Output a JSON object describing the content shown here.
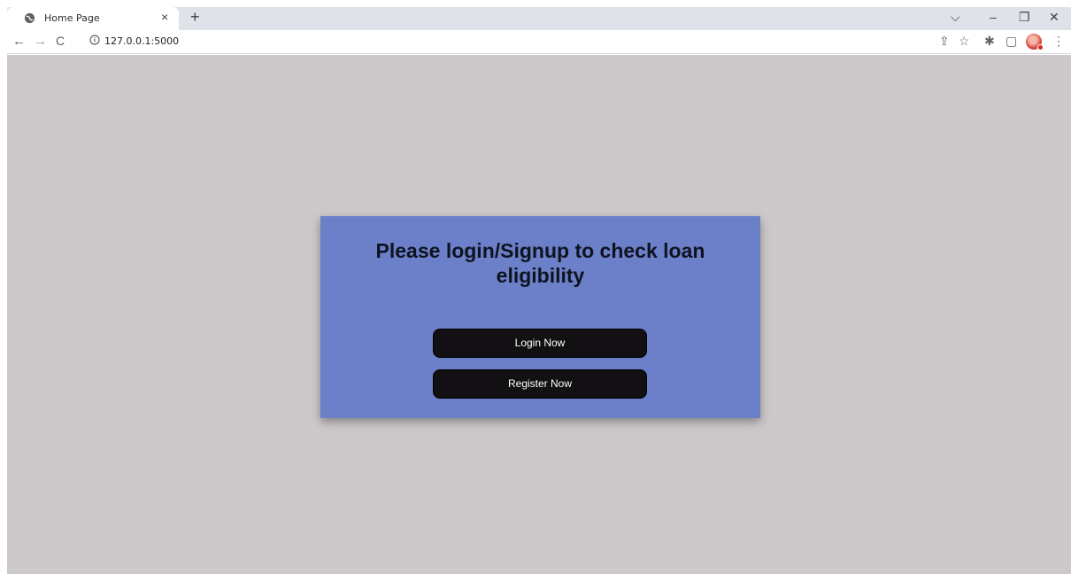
{
  "browser": {
    "tab_title": "Home Page",
    "tab_close": "×",
    "new_tab": "+",
    "url": "127.0.0.1:5000",
    "window_controls": {
      "dropdown": "⌵",
      "minimize": "–",
      "restore": "❐",
      "close": "✕"
    },
    "nav": {
      "back": "←",
      "forward": "→",
      "reload": "C"
    },
    "toolbar_icons": {
      "share": "⇪",
      "bookmark": "☆",
      "extensions": "✱",
      "sidebar": "▢",
      "menu": "⋮"
    }
  },
  "page": {
    "heading": "Please login/Signup to check loan eligibility",
    "login_button": "Login Now",
    "register_button": "Register Now"
  },
  "colors": {
    "page_background": "#cdc9ca",
    "card_background": "#6b80c8",
    "button_background": "#121012",
    "button_text": "#ffffff"
  }
}
